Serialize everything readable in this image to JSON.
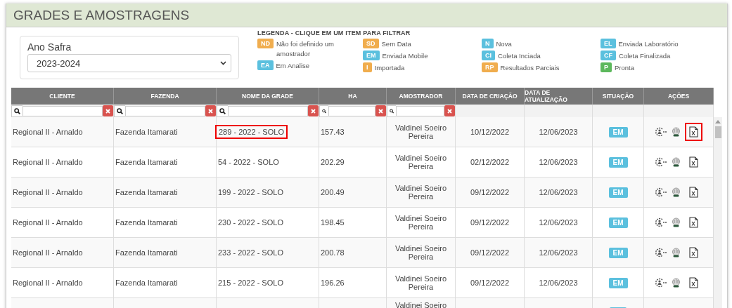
{
  "title": "GRADES E AMOSTRAGENS",
  "crop_year": {
    "label": "Ano Safra",
    "value": "2023-2024"
  },
  "legend": {
    "title": "LEGENDA - CLIQUE EM UM ITEM PARA FILTRAR",
    "columns": [
      [
        {
          "code": "ND",
          "text": "Não foi definido um amostrador",
          "color": "#f0ad4e"
        },
        {
          "code": "EA",
          "text": "Em Analise",
          "color": "#5bc0de"
        }
      ],
      [
        {
          "code": "SD",
          "text": "Sem Data",
          "color": "#f0ad4e"
        },
        {
          "code": "EM",
          "text": "Enviada Mobile",
          "color": "#5bc0de"
        },
        {
          "code": "I",
          "text": "Importada",
          "color": "#f0ad4e"
        }
      ],
      [
        {
          "code": "N",
          "text": "Nova",
          "color": "#5bc0de"
        },
        {
          "code": "CI",
          "text": "Coleta Inciada",
          "color": "#5bc0de"
        },
        {
          "code": "RP",
          "text": "Resultados Parciais",
          "color": "#f0ad4e"
        }
      ],
      [
        {
          "code": "EL",
          "text": "Enviada Laboratório",
          "color": "#5bc0de"
        },
        {
          "code": "CF",
          "text": "Coleta Finalizada",
          "color": "#5bc0de"
        },
        {
          "code": "P",
          "text": "Pronta",
          "color": "#5cb85c"
        }
      ]
    ]
  },
  "table": {
    "columns": [
      {
        "label": "CLIENTE",
        "filter": true
      },
      {
        "label": "FAZENDA",
        "filter": true
      },
      {
        "label": "NOME DA GRADE",
        "filter": true
      },
      {
        "label": "HA",
        "filter": true
      },
      {
        "label": "AMOSTRADOR",
        "filter": true
      },
      {
        "label": "DATA DE CRIAÇÃO",
        "filter": false
      },
      {
        "label": "DATA DE ATUALIZAÇÃO",
        "filter": false
      },
      {
        "label": "SITUAÇÃO",
        "filter": false
      },
      {
        "label": "AÇÕES",
        "filter": false
      }
    ],
    "rows": [
      {
        "cliente": "Regional II - Arnaldo",
        "fazenda": "Fazenda Itamarati",
        "grade": "289 - 2022 - SOLO",
        "ha": "157.43",
        "amostrador": "Valdinei Soeiro Pereira",
        "criacao": "10/12/2022",
        "atualizacao": "12/06/2023",
        "status": "EM",
        "color": "#5bc0de",
        "grade_highlighted": true,
        "export_highlighted": true
      },
      {
        "cliente": "Regional II - Arnaldo",
        "fazenda": "Fazenda Itamarati",
        "grade": "54 - 2022 - SOLO",
        "ha": "202.29",
        "amostrador": "Valdinei Soeiro Pereira",
        "criacao": "02/12/2022",
        "atualizacao": "12/06/2023",
        "status": "EM",
        "color": "#5bc0de",
        "grade_highlighted": false,
        "export_highlighted": false
      },
      {
        "cliente": "Regional II - Arnaldo",
        "fazenda": "Fazenda Itamarati",
        "grade": "199 - 2022 - SOLO",
        "ha": "200.49",
        "amostrador": "Valdinei Soeiro Pereira",
        "criacao": "09/12/2022",
        "atualizacao": "12/06/2023",
        "status": "EM",
        "color": "#5bc0de",
        "grade_highlighted": false,
        "export_highlighted": false
      },
      {
        "cliente": "Regional II - Arnaldo",
        "fazenda": "Fazenda Itamarati",
        "grade": "230 - 2022 - SOLO",
        "ha": "198.45",
        "amostrador": "Valdinei Soeiro Pereira",
        "criacao": "09/12/2022",
        "atualizacao": "12/06/2023",
        "status": "EM",
        "color": "#5bc0de",
        "grade_highlighted": false,
        "export_highlighted": false
      },
      {
        "cliente": "Regional II - Arnaldo",
        "fazenda": "Fazenda Itamarati",
        "grade": "233 - 2022 - SOLO",
        "ha": "200.78",
        "amostrador": "Valdinei Soeiro Pereira",
        "criacao": "09/12/2022",
        "atualizacao": "12/06/2023",
        "status": "EM",
        "color": "#5bc0de",
        "grade_highlighted": false,
        "export_highlighted": false
      },
      {
        "cliente": "Regional II - Arnaldo",
        "fazenda": "Fazenda Itamarati",
        "grade": "215 - 2022 - SOLO",
        "ha": "196.26",
        "amostrador": "Valdinei Soeiro Pereira",
        "criacao": "09/12/2022",
        "atualizacao": "12/06/2023",
        "status": "EM",
        "color": "#5bc0de",
        "grade_highlighted": false,
        "export_highlighted": false
      },
      {
        "amostrador": "Valdinei Soeiro",
        "color": "#5bc0de"
      }
    ]
  }
}
